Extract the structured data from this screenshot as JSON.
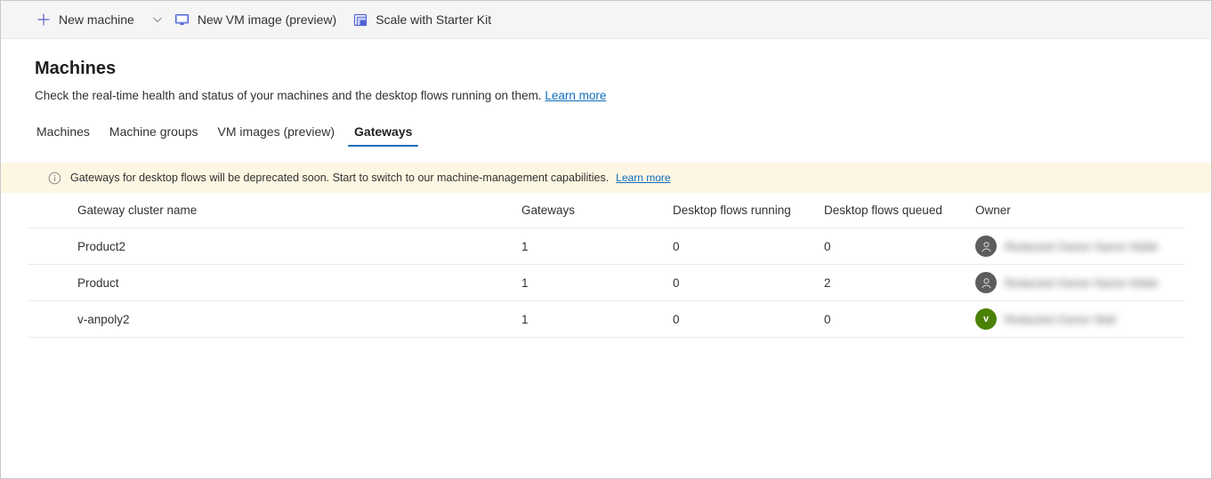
{
  "commandbar": {
    "buttons": [
      {
        "label": "New machine",
        "icon": "plus-icon",
        "has_chevron": true
      },
      {
        "label": "New VM image (preview)",
        "icon": "monitor-icon",
        "has_chevron": false
      },
      {
        "label": "Scale with Starter Kit",
        "icon": "scale-icon",
        "has_chevron": false
      }
    ]
  },
  "header": {
    "title": "Machines",
    "description": "Check the real-time health and status of your machines and the desktop flows running on them.",
    "learn_more": "Learn more"
  },
  "tabs": [
    {
      "label": "Machines",
      "selected": false
    },
    {
      "label": "Machine groups",
      "selected": false
    },
    {
      "label": "VM images (preview)",
      "selected": false
    },
    {
      "label": "Gateways",
      "selected": true
    }
  ],
  "banner": {
    "icon": "info-icon",
    "text": "Gateways for desktop flows will be deprecated soon. Start to switch to our machine-management capabilities.",
    "learn_more": "Learn more",
    "background": "#fdf6e3"
  },
  "table": {
    "columns": [
      "Gateway cluster name",
      "Gateways",
      "Desktop flows running",
      "Desktop flows queued",
      "Owner"
    ],
    "rows": [
      {
        "name": "Product2",
        "gateways": "1",
        "running": "0",
        "queued": "0",
        "owner_name": "Redacted Owner Name Hidden",
        "avatar_kind": "generic",
        "avatar_initial": ""
      },
      {
        "name": "Product",
        "gateways": "1",
        "running": "0",
        "queued": "2",
        "owner_name": "Redacted Owner Name Hidden",
        "avatar_kind": "generic",
        "avatar_initial": ""
      },
      {
        "name": "v-anpoly2",
        "gateways": "1",
        "running": "0",
        "queued": "0",
        "owner_name": "Redacted Owner Mail",
        "avatar_kind": "initial",
        "avatar_initial": "v"
      }
    ]
  },
  "colors": {
    "accent": "#0f6cbd",
    "link": "#0f6cbd",
    "banner_bg": "#fdf6e3",
    "avatar_green": "#498205",
    "avatar_grey": "#5d5d5d",
    "commandbar_bg": "#f5f5f5"
  }
}
